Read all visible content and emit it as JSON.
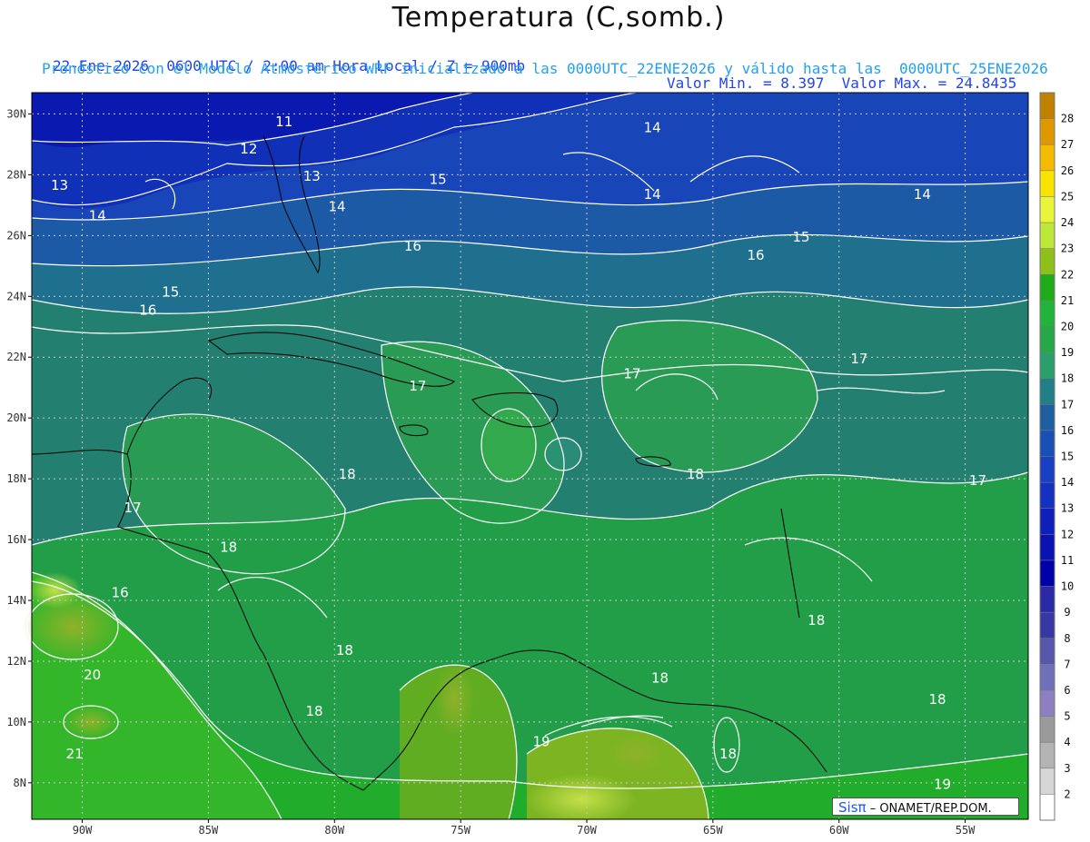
{
  "header": {
    "title": "Temperatura (C,somb.)",
    "line1_left": "22-Ene-2026  0600 UTC / 2:00 am Hora Local / Z = 900mb",
    "line1_right": "Valor Min. = 8.397  Valor Max. = 24.8435",
    "line2": "Pronóstico con el Modelo Atmósferico WRF inicializado a las 0000UTC_22ENE2026 y válido hasta las  0000UTC_25ENE2026"
  },
  "map": {
    "type": "temperature-contour-map",
    "lon_ticks": [
      "90W",
      "85W",
      "80W",
      "75W",
      "70W",
      "65W",
      "60W",
      "55W"
    ],
    "lon_values": [
      -90,
      -85,
      -80,
      -75,
      -70,
      -65,
      -60,
      -55
    ],
    "lat_ticks": [
      "30N",
      "28N",
      "26N",
      "24N",
      "22N",
      "20N",
      "18N",
      "16N",
      "14N",
      "12N",
      "10N",
      "8N"
    ],
    "lat_values": [
      30,
      28,
      26,
      24,
      22,
      20,
      18,
      16,
      14,
      12,
      10,
      8
    ],
    "lon_range": [
      -92,
      -52.5
    ],
    "lat_range": [
      6.8,
      30.7
    ],
    "grid": true,
    "contour_labels": [
      {
        "text": "11",
        "lon": -82.0,
        "lat": 29.6
      },
      {
        "text": "12",
        "lon": -83.4,
        "lat": 28.7
      },
      {
        "text": "13",
        "lon": -80.9,
        "lat": 27.8
      },
      {
        "text": "13",
        "lon": -90.9,
        "lat": 27.5
      },
      {
        "text": "14",
        "lon": -89.4,
        "lat": 26.5
      },
      {
        "text": "14",
        "lon": -79.9,
        "lat": 26.8
      },
      {
        "text": "15",
        "lon": -75.9,
        "lat": 27.7
      },
      {
        "text": "14",
        "lon": -67.4,
        "lat": 29.4
      },
      {
        "text": "14",
        "lon": -67.4,
        "lat": 27.2
      },
      {
        "text": "14",
        "lon": -56.7,
        "lat": 27.2
      },
      {
        "text": "16",
        "lon": -76.9,
        "lat": 25.5
      },
      {
        "text": "15",
        "lon": -61.5,
        "lat": 25.8
      },
      {
        "text": "16",
        "lon": -63.3,
        "lat": 25.2
      },
      {
        "text": "15",
        "lon": -86.5,
        "lat": 24.0
      },
      {
        "text": "16",
        "lon": -87.4,
        "lat": 23.4
      },
      {
        "text": "17",
        "lon": -68.2,
        "lat": 21.3
      },
      {
        "text": "17",
        "lon": -76.7,
        "lat": 20.9
      },
      {
        "text": "17",
        "lon": -59.2,
        "lat": 21.8
      },
      {
        "text": "18",
        "lon": -79.5,
        "lat": 18.0
      },
      {
        "text": "18",
        "lon": -65.7,
        "lat": 18.0
      },
      {
        "text": "17",
        "lon": -54.5,
        "lat": 17.8
      },
      {
        "text": "17",
        "lon": -88.0,
        "lat": 16.9
      },
      {
        "text": "18",
        "lon": -84.2,
        "lat": 15.6
      },
      {
        "text": "16",
        "lon": -88.5,
        "lat": 14.1
      },
      {
        "text": "18",
        "lon": -60.9,
        "lat": 13.2
      },
      {
        "text": "18",
        "lon": -79.6,
        "lat": 12.2
      },
      {
        "text": "20",
        "lon": -89.6,
        "lat": 11.4
      },
      {
        "text": "18",
        "lon": -67.1,
        "lat": 11.3
      },
      {
        "text": "18",
        "lon": -80.8,
        "lat": 10.2
      },
      {
        "text": "18",
        "lon": -56.1,
        "lat": 10.6
      },
      {
        "text": "19",
        "lon": -71.8,
        "lat": 9.2
      },
      {
        "text": "18",
        "lon": -64.4,
        "lat": 8.8
      },
      {
        "text": "21",
        "lon": -90.3,
        "lat": 8.8
      },
      {
        "text": "19",
        "lon": -55.9,
        "lat": 7.8
      }
    ],
    "credit_logo": "Sisπ",
    "credit_text": "– ONAMET/REP.DOM."
  },
  "colorbar": {
    "labels": [
      "28",
      "27",
      "26",
      "25",
      "24",
      "23",
      "22",
      "21",
      "20",
      "19",
      "18",
      "17",
      "16",
      "15",
      "14",
      "13",
      "12",
      "11",
      "10",
      "9",
      "8",
      "7",
      "6",
      "5",
      "4",
      "3",
      "2"
    ],
    "colors": [
      "#c08000",
      "#e09800",
      "#f5bb00",
      "#f7e400",
      "#e8f53b",
      "#bde838",
      "#8fc01a",
      "#1fac1a",
      "#22b33a",
      "#27a848",
      "#2b9f6a",
      "#217f88",
      "#1f5fa0",
      "#1a4fb3",
      "#1840c3",
      "#1431c2",
      "#0f20ba",
      "#0b12b2",
      "#0000a8",
      "#2a2aa6",
      "#3838a4",
      "#5656aa",
      "#7070b8",
      "#8c80c0",
      "#9a9a9a",
      "#b4b4b4",
      "#d6d6d6",
      "#ffffff"
    ]
  }
}
